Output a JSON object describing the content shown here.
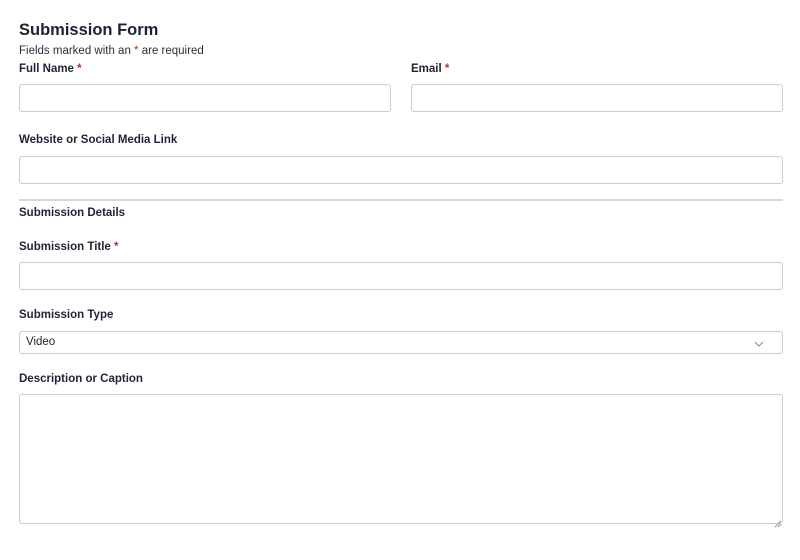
{
  "form": {
    "title": "Submission Form",
    "note_prefix": "Fields marked with an ",
    "note_star": "*",
    "note_suffix": " are required"
  },
  "fields": {
    "full_name": {
      "label": "Full Name",
      "required_mark": "*",
      "value": ""
    },
    "email": {
      "label": "Email",
      "required_mark": "*",
      "value": ""
    },
    "website": {
      "label": "Website or Social Media Link",
      "value": ""
    }
  },
  "details": {
    "section_title": "Submission Details",
    "title_field": {
      "label": "Submission Title",
      "required_mark": "*",
      "value": ""
    },
    "type_field": {
      "label": "Submission Type",
      "selected": "Video",
      "icon": "chevron-down-icon"
    },
    "description_field": {
      "label": "Description or Caption",
      "value": ""
    }
  },
  "colors": {
    "required": "#d1242f",
    "border": "#c9ccd3",
    "divider": "#d4d8e6"
  }
}
